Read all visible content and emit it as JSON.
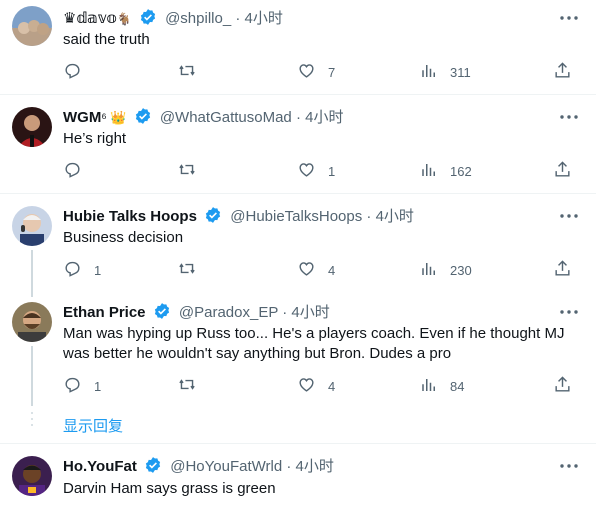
{
  "tweets": [
    {
      "name": "♛𝕕𝕒𝕧𝕠",
      "name_suffix": "🐐",
      "handle": "@shpillo_",
      "dot": "·",
      "time": "4小时",
      "text": "said the truth",
      "replies": "",
      "retweets": "",
      "likes": "7",
      "views": "311",
      "avatar_bg": "#c7a98a"
    },
    {
      "name": "WGM",
      "name_suffix": "⁶ 👑",
      "handle": "@WhatGattusoMad",
      "dot": "·",
      "time": "4小时",
      "text": "He’s right",
      "replies": "",
      "retweets": "",
      "likes": "1",
      "views": "162",
      "avatar_bg": "#8b1c1c"
    },
    {
      "name": "Hubie Talks Hoops",
      "name_suffix": "",
      "handle": "@HubieTalksHoops",
      "dot": "·",
      "time": "4小时",
      "text": "Business decision",
      "replies": "1",
      "retweets": "",
      "likes": "4",
      "views": "230",
      "avatar_bg": "#3a5a8c"
    },
    {
      "name": "Ethan Price",
      "name_suffix": "",
      "handle": "@Paradox_EP",
      "dot": "·",
      "time": "4小时",
      "text": "Man was hyping up Russ too... He's a players coach. Even if he thought MJ was better he wouldn't say anything but Bron. Dudes a pro",
      "replies": "1",
      "retweets": "",
      "likes": "4",
      "views": "84",
      "avatar_bg": "#6b5a3e"
    },
    {
      "name": "Ho.YouFat",
      "name_suffix": "",
      "handle": "@HoYouFatWrld",
      "dot": "·",
      "time": "4小时",
      "text": "Darvin Ham says grass is green",
      "replies": "",
      "retweets": "",
      "likes": "",
      "views": "",
      "avatar_bg": "#5b2a86"
    }
  ],
  "show_replies": "显示回复",
  "colors": {
    "accent": "#1d9bf0",
    "secondary_text": "#536471",
    "divider": "#eff3f4"
  }
}
